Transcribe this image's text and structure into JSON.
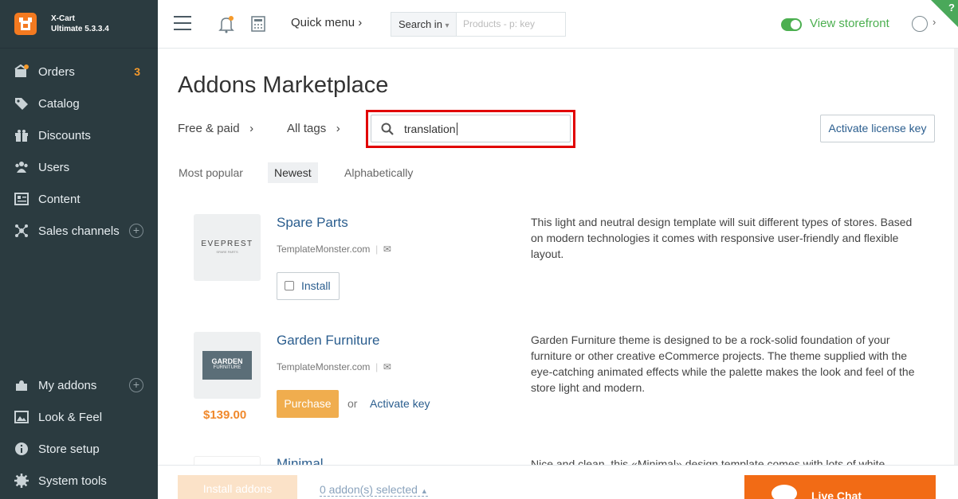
{
  "brand": {
    "name": "X-Cart",
    "version": "Ultimate 5.3.3.4"
  },
  "sidebar": {
    "items": [
      {
        "label": "Orders",
        "badge": "3"
      },
      {
        "label": "Catalog"
      },
      {
        "label": "Discounts"
      },
      {
        "label": "Users"
      },
      {
        "label": "Content"
      },
      {
        "label": "Sales channels"
      }
    ],
    "bottom_items": [
      {
        "label": "My addons"
      },
      {
        "label": "Look & Feel"
      },
      {
        "label": "Store setup"
      },
      {
        "label": "System tools"
      }
    ]
  },
  "header": {
    "quick_menu": "Quick menu",
    "search_in": "Search in",
    "search_placeholder": "Products - p: key",
    "view_storefront": "View storefront"
  },
  "main": {
    "title": "Addons Marketplace",
    "filters": {
      "price": "Free & paid",
      "tags": "All tags"
    },
    "search_value": "translation",
    "activate_license": "Activate license key",
    "sort": [
      "Most popular",
      "Newest",
      "Alphabetically"
    ],
    "items": [
      {
        "title": "Spare Parts",
        "vendor": "TemplateMonster.com",
        "thumb_text": "EVEPREST",
        "thumb_sub": "SPARE PARTS",
        "description": "This light and neutral design template will suit different types of stores. Based on modern technologies it comes with responsive user-friendly and flexible layout.",
        "action": "Install"
      },
      {
        "title": "Garden Furniture",
        "vendor": "TemplateMonster.com",
        "thumb_text": "GARDEN",
        "thumb_sub": "FURNITURE",
        "description": "Garden Furniture theme is designed to be a rock-solid foundation of your furniture or other creative eCommerce projects. The theme supplied with the eye-catching animated effects while the palette makes the look and feel of the store light and modern.",
        "action": "Purchase",
        "or": "or",
        "activate_key": "Activate key",
        "price": "$139.00"
      },
      {
        "title": "Minimal",
        "description": "Nice and clean, this «Minimal» design template comes with lots of white"
      }
    ]
  },
  "bottom": {
    "install_addons": "Install addons",
    "selected": "0 addon(s) selected",
    "live_chat": "Live Chat"
  },
  "colors": {
    "accent": "#f47a20",
    "link": "#2a5d8e",
    "success": "#4caf50",
    "highlight": "#e10000"
  }
}
